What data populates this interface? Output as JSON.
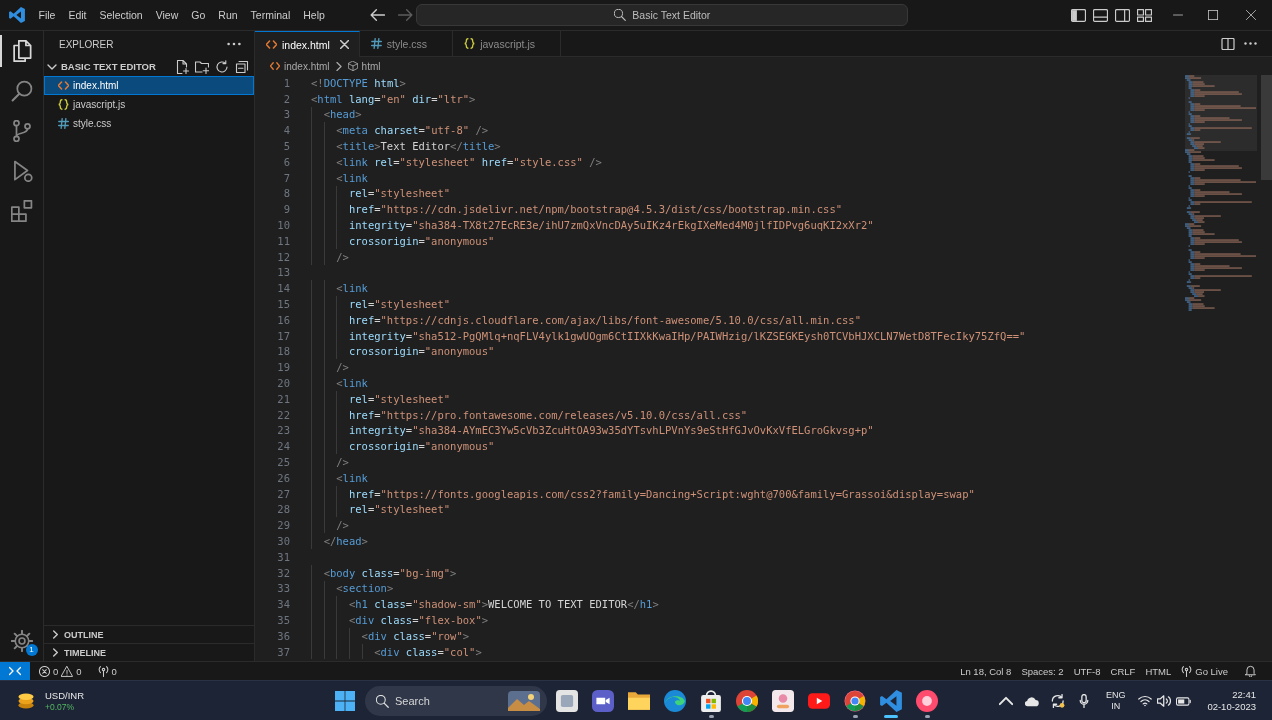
{
  "title_bar": {
    "menu": [
      "File",
      "Edit",
      "Selection",
      "View",
      "Go",
      "Run",
      "Terminal",
      "Help"
    ],
    "navigation": [
      {
        "kind": "back",
        "disabled": false
      },
      {
        "kind": "forward",
        "disabled": true
      }
    ],
    "command_center": "Basic Text Editor"
  },
  "activity_bar": {
    "items": [
      {
        "kind": "explorer",
        "selected": true
      },
      {
        "kind": "search",
        "selected": false
      },
      {
        "kind": "source-control",
        "selected": false
      },
      {
        "kind": "run",
        "selected": false
      },
      {
        "kind": "extensions",
        "selected": false
      }
    ],
    "manage_badge": "1"
  },
  "sidebar": {
    "title": "EXPLORER",
    "folder": {
      "name": "BASIC TEXT EDITOR",
      "expanded": true,
      "files": [
        {
          "name": "index.html",
          "kind": "html",
          "selected": true
        },
        {
          "name": "javascript.js",
          "kind": "js",
          "selected": false
        },
        {
          "name": "style.css",
          "kind": "css",
          "selected": false
        }
      ]
    },
    "panels": [
      {
        "name": "OUTLINE",
        "expanded": false
      },
      {
        "name": "TIMELINE",
        "expanded": false
      }
    ]
  },
  "tabs": [
    {
      "label": "index.html",
      "kind": "html",
      "selected": true
    },
    {
      "label": "style.css",
      "kind": "css",
      "selected": false
    },
    {
      "label": "javascript.js",
      "kind": "js",
      "selected": false
    }
  ],
  "breadcrumbs": [
    {
      "label": "index.html",
      "kind": "html"
    },
    {
      "label": "html",
      "kind": "element"
    }
  ],
  "editor": {
    "lines": [
      {
        "number": "1",
        "code": "<!DOCTYPE html>"
      },
      {
        "number": "2",
        "code": "<html lang=\"en\" dir=\"ltr\">"
      },
      {
        "number": "3",
        "code": "  <head>"
      },
      {
        "number": "4",
        "code": "    <meta charset=\"utf-8\" />"
      },
      {
        "number": "5",
        "code": "    <title>Text Editor</title>"
      },
      {
        "number": "6",
        "code": "    <link rel=\"stylesheet\" href=\"style.css\" />"
      },
      {
        "number": "7",
        "code": "    <link"
      },
      {
        "number": "8",
        "code": "      rel=\"stylesheet\""
      },
      {
        "number": "9",
        "code": "      href=\"https://cdn.jsdelivr.net/npm/bootstrap@4.5.3/dist/css/bootstrap.min.css\""
      },
      {
        "number": "10",
        "code": "      integrity=\"sha384-TX8t27EcRE3e/ihU7zmQxVncDAy5uIKz4rEkgIXeMed4M0jlfIDPvg6uqKI2xXr2\""
      },
      {
        "number": "11",
        "code": "      crossorigin=\"anonymous\""
      },
      {
        "number": "12",
        "code": "    />"
      },
      {
        "number": "13"
      },
      {
        "number": "14",
        "code": "    <link"
      },
      {
        "number": "15",
        "code": "      rel=\"stylesheet\""
      },
      {
        "number": "16",
        "code": "      href=\"https://cdnjs.cloudflare.com/ajax/libs/font-awesome/5.10.0/css/all.min.css\""
      },
      {
        "number": "17",
        "code": "      integrity=\"sha512-PgQMlq+nqFLV4ylk1gwUOgm6CtIIXkKwaIHp/PAIWHzig/lKZSEGKEysh0TCVbHJXCLN7WetD8TFecIky75ZfQ==\""
      },
      {
        "number": "18",
        "code": "      crossorigin=\"anonymous\""
      },
      {
        "number": "19",
        "code": "    />"
      },
      {
        "number": "20",
        "code": "    <link"
      },
      {
        "number": "21",
        "code": "      rel=\"stylesheet\""
      },
      {
        "number": "22",
        "code": "      href=\"https://pro.fontawesome.com/releases/v5.10.0/css/all.css\""
      },
      {
        "number": "23",
        "code": "      integrity=\"sha384-AYmEC3Yw5cVb3ZcuHtOA93w35dYTsvhLPVnYs9eStHfGJvOvKxVfELGroGkvsg+p\""
      },
      {
        "number": "24",
        "code": "      crossorigin=\"anonymous\""
      },
      {
        "number": "25",
        "code": "    />"
      },
      {
        "number": "26",
        "code": "    <link"
      },
      {
        "number": "27",
        "code": "      href=\"https://fonts.googleapis.com/css2?family=Dancing+Script:wght@700&family=Grassoi&display=swap\""
      },
      {
        "number": "28",
        "code": "      rel=\"stylesheet\""
      },
      {
        "number": "29",
        "code": "    />"
      },
      {
        "number": "30",
        "code": "  </head>"
      },
      {
        "number": "31"
      },
      {
        "number": "32",
        "code": "  <body class=\"bg-img\">"
      },
      {
        "number": "33",
        "code": "    <section>"
      },
      {
        "number": "34",
        "code": "      <h1 class=\"shadow-sm\">WELCOME TO TEXT EDITOR</h1>"
      },
      {
        "number": "35",
        "code": "      <div class=\"flex-box\">"
      },
      {
        "number": "36",
        "code": "        <div class=\"row\">"
      },
      {
        "number": "37",
        "code": "          <div class=\"col\">"
      }
    ]
  },
  "status_bar": {
    "errors": "0",
    "warnings": "0",
    "ports": "0",
    "items": [
      "Ln 18, Col 8",
      "Spaces: 2",
      "UTF-8",
      "CRLF",
      "HTML"
    ],
    "live_server": "Go Live"
  },
  "taskbar": {
    "widget": {
      "title": "USD/INR",
      "change": "+0.07%"
    },
    "search": {
      "placeholder": "Search"
    },
    "apps": [
      {
        "kind": "squares",
        "running": false,
        "selected": false
      },
      {
        "kind": "camera",
        "running": false,
        "selected": false
      },
      {
        "kind": "folder",
        "running": false,
        "selected": false
      },
      {
        "kind": "swirl",
        "running": false,
        "selected": false
      },
      {
        "kind": "bag",
        "running": true,
        "selected": false
      },
      {
        "kind": "tricolor",
        "running": false,
        "selected": false
      },
      {
        "kind": "tile",
        "running": false,
        "selected": false
      },
      {
        "kind": "play",
        "running": false,
        "selected": false
      },
      {
        "kind": "ring",
        "running": true,
        "selected": false
      },
      {
        "kind": "ribbon",
        "running": true,
        "selected": true
      },
      {
        "kind": "record",
        "running": true,
        "selected": false
      }
    ],
    "tray": {
      "language": "ENG",
      "region": "IN",
      "time": "22:41",
      "date": "02-10-2023"
    }
  }
}
